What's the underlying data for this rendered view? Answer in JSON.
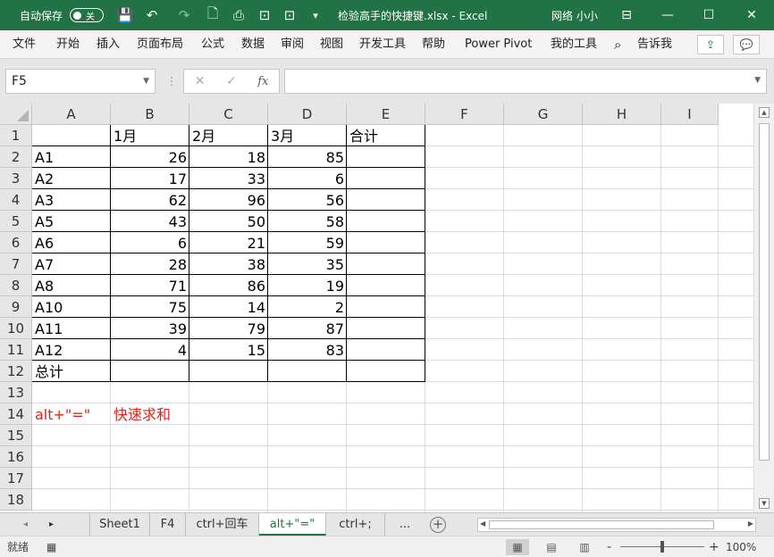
{
  "titlebar": {
    "autosave_label": "自动保存",
    "autosave_state": "关",
    "doc_title": "检验高手的快捷键.xlsx  -  Excel",
    "user": "网络 小小",
    "icons": {
      "save": "💾",
      "undo": "↶",
      "redo": "↷",
      "new": "🗋",
      "print": "⎙",
      "format": "⊡",
      "more": "▾"
    },
    "win": {
      "ribbon_opt": "⊟",
      "minimize": "—",
      "restore": "☐",
      "close": "✕"
    }
  },
  "menu": {
    "items": [
      "文件",
      "开始",
      "插入",
      "页面布局",
      "公式",
      "数据",
      "审阅",
      "视图",
      "开发工具",
      "帮助",
      "Power Pivot",
      "我的工具"
    ],
    "search_icon": "⌕",
    "tell_me": "告诉我",
    "share_icon": "⇪",
    "comment_icon": "💬"
  },
  "formula": {
    "name_box": "F5",
    "cancel": "✕",
    "enter": "✓",
    "fx": "fx",
    "sep": "⋮",
    "value": ""
  },
  "grid": {
    "columns": [
      "A",
      "B",
      "C",
      "D",
      "E",
      "F",
      "G",
      "H",
      "I"
    ],
    "rows": [
      "1",
      "2",
      "3",
      "4",
      "5",
      "6",
      "7",
      "8",
      "9",
      "10",
      "11",
      "12",
      "13",
      "14",
      "15",
      "16",
      "17",
      "18"
    ],
    "header_row": [
      "",
      "1月",
      "2月",
      "3月",
      "合计"
    ],
    "data": [
      [
        "A1",
        "26",
        "18",
        "85"
      ],
      [
        "A2",
        "17",
        "33",
        "6"
      ],
      [
        "A3",
        "62",
        "96",
        "56"
      ],
      [
        "A5",
        "43",
        "50",
        "58"
      ],
      [
        "A6",
        "6",
        "21",
        "59"
      ],
      [
        "A7",
        "28",
        "38",
        "35"
      ],
      [
        "A8",
        "71",
        "86",
        "19"
      ],
      [
        "A10",
        "75",
        "14",
        "2"
      ],
      [
        "A11",
        "39",
        "79",
        "87"
      ],
      [
        "A12",
        "4",
        "15",
        "83"
      ]
    ],
    "total_label": "总计",
    "note_shortcut": "alt+\"=\"",
    "note_desc": "快速求和"
  },
  "sheets": {
    "nav_prev": "◂",
    "nav_next": "▸",
    "tabs": [
      "Sheet1",
      "F4",
      "ctrl+回车",
      "alt+\"=\"",
      "ctrl+;",
      "..."
    ],
    "active": "alt+\"=\"",
    "add": "+"
  },
  "status": {
    "ready": "就绪",
    "macro_icon": "▦",
    "view_normal": "▦",
    "view_layout": "▤",
    "view_break": "▥",
    "zoom_minus": "-",
    "zoom_plus": "+",
    "zoom": "100%",
    "zoom_fraction": 0.5
  },
  "colors": {
    "brand": "#217346",
    "red_text": "#d9261c"
  }
}
